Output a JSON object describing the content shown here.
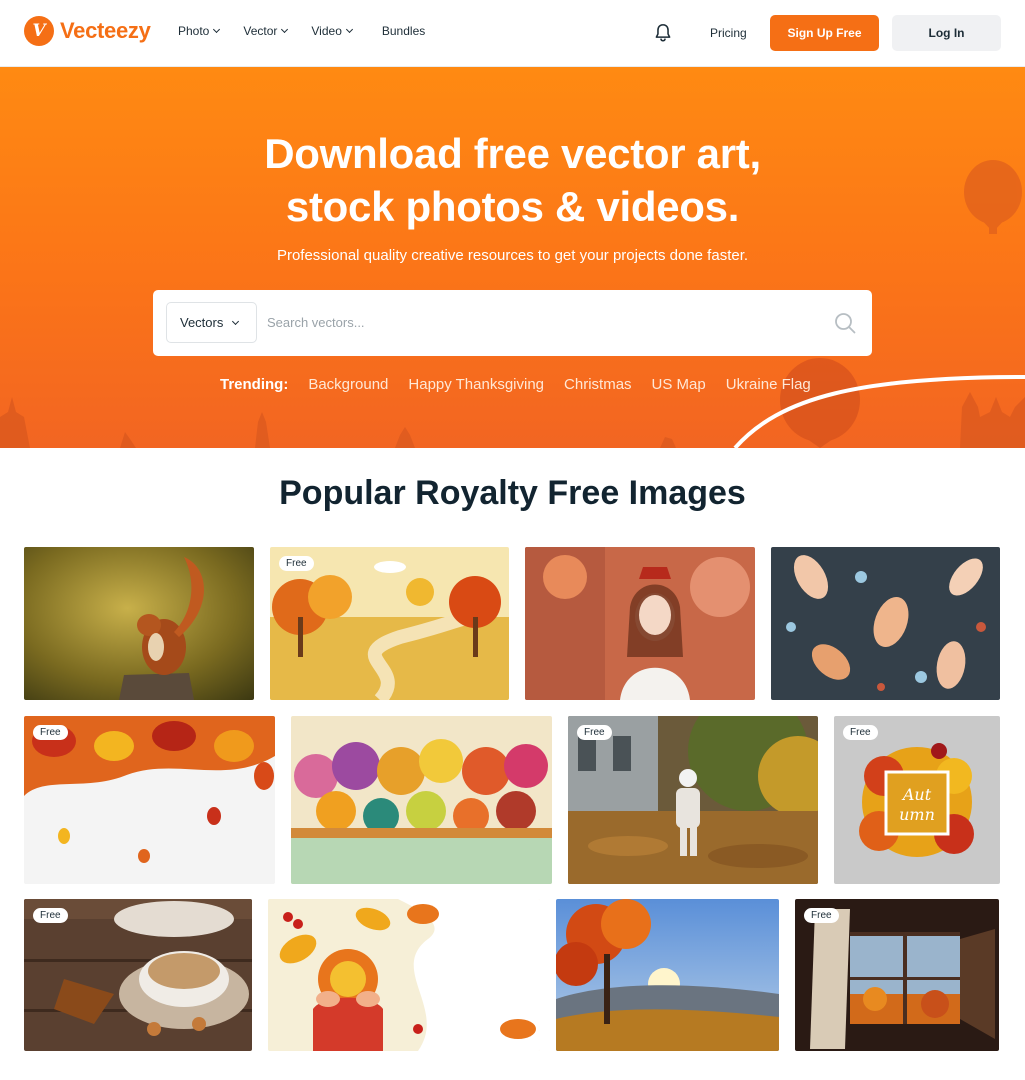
{
  "brand": {
    "name": "Vecteezy",
    "mark": "V",
    "color": "#f56f15"
  },
  "nav": [
    {
      "label": "Photo",
      "dropdown": true
    },
    {
      "label": "Vector",
      "dropdown": true
    },
    {
      "label": "Video",
      "dropdown": true
    },
    {
      "label": "Bundles",
      "dropdown": false
    }
  ],
  "header": {
    "pricing_label": "Pricing",
    "signup_label": "Sign Up Free",
    "login_label": "Log In",
    "notification_icon": "bell-icon"
  },
  "hero": {
    "title_line1": "Download free vector art,",
    "title_line2": "stock photos & videos.",
    "subtitle": "Professional quality creative resources to get your projects done faster.",
    "search": {
      "category": "Vectors",
      "placeholder": "Search vectors...",
      "value": ""
    },
    "trending_label": "Trending:",
    "trending": [
      "Background",
      "Happy Thanksgiving",
      "Christmas",
      "US Map",
      "Ukraine Flag"
    ]
  },
  "gallery": {
    "title": "Popular Royalty Free Images",
    "badge_label": "Free",
    "rows": [
      [
        {
          "subject": "squirrel-photo",
          "free": false
        },
        {
          "subject": "autumn-park-illustration",
          "free": true
        },
        {
          "subject": "woman-autumn-leaves-photo",
          "free": false
        },
        {
          "subject": "leaf-pattern",
          "free": false
        }
      ],
      [
        {
          "subject": "autumn-leaves-border",
          "free": true
        },
        {
          "subject": "colorful-forest-illustration",
          "free": true
        },
        {
          "subject": "child-autumn-leaves-photo",
          "free": true
        },
        {
          "subject": "autumn-wreath-frame",
          "free": true
        }
      ],
      [
        {
          "subject": "coffee-cup-photo",
          "free": true
        },
        {
          "subject": "hands-tea-cup-illustration",
          "free": false
        },
        {
          "subject": "autumn-tree-sunset-photo",
          "free": false
        },
        {
          "subject": "window-autumn-view-photo",
          "free": true
        }
      ]
    ]
  }
}
